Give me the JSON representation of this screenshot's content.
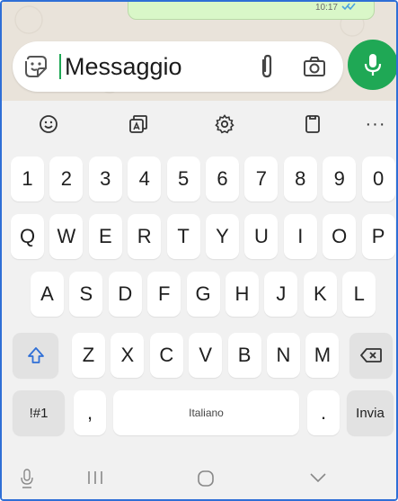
{
  "status": {
    "time": "10:17"
  },
  "composer": {
    "placeholder": "Messaggio",
    "accent_color": "#1fa855",
    "icons": [
      "sticker-icon",
      "attach-icon",
      "camera-icon",
      "mic-icon"
    ]
  },
  "keyboard_toolbar": {
    "icons": [
      "emoji-icon",
      "ai-keyboard-icon",
      "settings-icon",
      "clipboard-icon"
    ],
    "more_label": "···"
  },
  "keyboard": {
    "number_row": [
      "1",
      "2",
      "3",
      "4",
      "5",
      "6",
      "7",
      "8",
      "9",
      "0"
    ],
    "row1": [
      "Q",
      "W",
      "E",
      "R",
      "T",
      "Y",
      "U",
      "I",
      "O",
      "P"
    ],
    "row2": [
      "A",
      "S",
      "D",
      "F",
      "G",
      "H",
      "J",
      "K",
      "L"
    ],
    "row3": [
      "Z",
      "X",
      "C",
      "V",
      "B",
      "N",
      "M"
    ],
    "symbols_label": "!#1",
    "comma_label": ",",
    "space_label": "Italiano",
    "period_label": ".",
    "send_label": "Invia",
    "shift_color": "#2f6fd6"
  },
  "navbar": {
    "icons": [
      "keyboard-mic-icon",
      "recent-apps-icon",
      "home-icon",
      "back-icon"
    ]
  }
}
